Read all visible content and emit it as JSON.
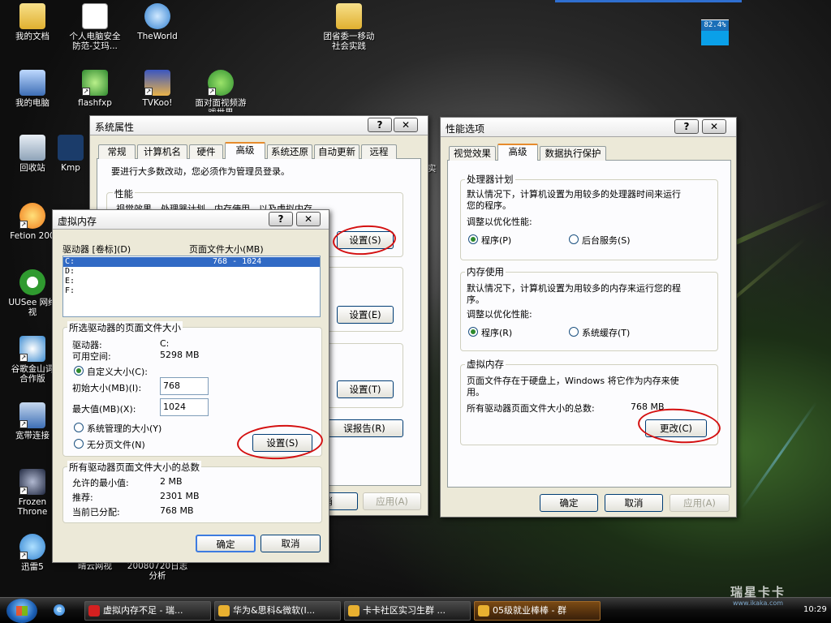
{
  "desktop": {
    "icons": [
      {
        "label": "我的文档"
      },
      {
        "label": "个人电脑安全\n防范-艾玛..."
      },
      {
        "label": "TheWorld"
      },
      {
        "label": "团省委一移动\n社会实践"
      },
      {
        "label": "我的电脑"
      },
      {
        "label": "flashfxp"
      },
      {
        "label": "TVKoo!"
      },
      {
        "label": "面对面视频游\n戏世界"
      },
      {
        "label": "回收站"
      },
      {
        "label": "Kmp"
      },
      {
        "label": "Fetion 200"
      },
      {
        "label": "UUSee 网络\n视"
      },
      {
        "label": "谷歌金山词\n合作版"
      },
      {
        "label": "宽带连接"
      },
      {
        "label": "Frozen\nThrone"
      },
      {
        "label": "迅雷5"
      },
      {
        "label": "晴云网视"
      },
      {
        "label": "20080720日志\n分析"
      },
      {
        "label": "实"
      }
    ],
    "cpu_meter": "82.4%"
  },
  "sysprops": {
    "title": "系统属性",
    "help": "?",
    "close": "✕",
    "tabs": [
      "常规",
      "计算机名",
      "硬件",
      "高级",
      "系统还原",
      "自动更新",
      "远程"
    ],
    "admin_note": "要进行大多数改动，您必须作为管理员登录。",
    "perf_group": "性能",
    "perf_desc": "视觉效果，处理器计划，内存使用，以及虚拟内存",
    "settings_btn": "设置(S)",
    "settings_btn_e": "设置(E)",
    "settings_btn_t": "设置(T)",
    "error_report_btn": "误报告(R)",
    "ok": "确定",
    "cancel": "消",
    "apply": "应用(A)"
  },
  "virtmem": {
    "title": "虚拟内存",
    "help": "?",
    "close": "✕",
    "col_drive": "驱动器 [卷标](D)",
    "col_pagefile": "页面文件大小(MB)",
    "drives": [
      {
        "drive": "C:",
        "size": "768 - 1024"
      },
      {
        "drive": "D:",
        "size": ""
      },
      {
        "drive": "E:",
        "size": ""
      },
      {
        "drive": "F:",
        "size": ""
      }
    ],
    "selected_group": "所选驱动器的页面文件大小",
    "drive_label": "驱动器:",
    "drive_value": "C:",
    "free_label": "可用空间:",
    "free_value": "5298 MB",
    "custom_size": "自定义大小(C):",
    "initial_label": "初始大小(MB)(I):",
    "initial_value": "768",
    "max_label": "最大值(MB)(X):",
    "max_value": "1024",
    "system_managed": "系统管理的大小(Y)",
    "no_pagefile": "无分页文件(N)",
    "set_btn": "设置(S)",
    "total_group": "所有驱动器页面文件大小的总数",
    "min_label": "允许的最小值:",
    "min_value": "2 MB",
    "rec_label": "推荐:",
    "rec_value": "2301 MB",
    "cur_label": "当前已分配:",
    "cur_value": "768 MB",
    "ok": "确定",
    "cancel": "取消"
  },
  "perfopts": {
    "title": "性能选项",
    "help": "?",
    "close": "✕",
    "tabs": [
      "视觉效果",
      "高级",
      "数据执行保护"
    ],
    "cpu_group": "处理器计划",
    "cpu_desc1": "默认情况下，计算机设置为用较多的处理器时间来运行",
    "cpu_desc2": "您的程序。",
    "optimize": "调整以优化性能:",
    "programs": "程序(P)",
    "bg_services": "后台服务(S)",
    "mem_group": "内存使用",
    "mem_desc1": "默认情况下，计算机设置为用较多的内存来运行您的程",
    "mem_desc2": "序。",
    "programs_r": "程序(R)",
    "sys_cache": "系统缓存(T)",
    "vm_group": "虚拟内存",
    "vm_desc1": "页面文件存在于硬盘上，Windows 将它作为内存来使",
    "vm_desc2": "用。",
    "vm_total_label": "所有驱动器页面文件大小的总数:",
    "vm_total_value": "768 MB",
    "change_btn": "更改(C)",
    "ok": "确定",
    "cancel": "取消",
    "apply": "应用(A)"
  },
  "taskbar": {
    "tasks": [
      "虚拟内存不足 - 瑞...",
      "华为&思科&微软(I...",
      "卡卡社区实习生群 ...",
      "05级就业棒棒 - 群"
    ],
    "clock": "10:29",
    "watermark": "瑞星卡卡",
    "watermark_url": "www.ikaka.com"
  }
}
